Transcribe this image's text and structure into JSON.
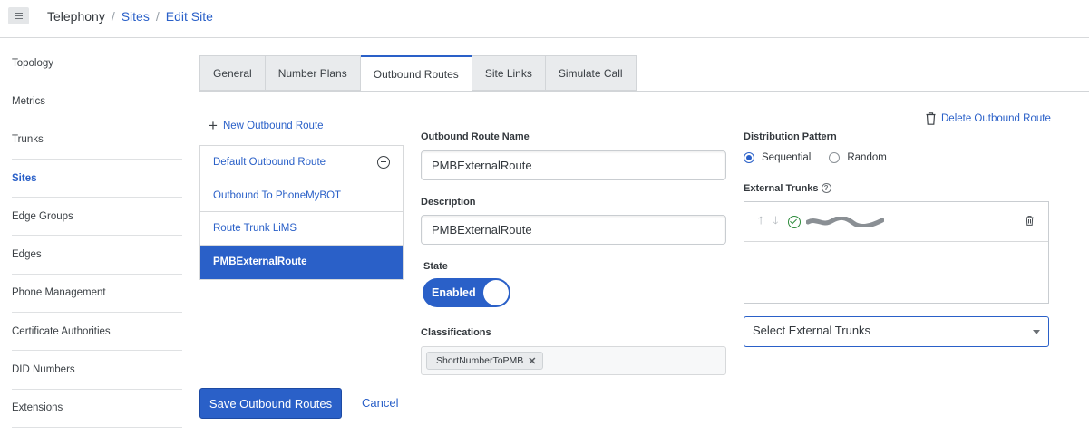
{
  "header": {
    "breadcrumb": [
      "Telephony",
      "Sites",
      "Edit Site"
    ],
    "menu_icon": "hamburger-icon"
  },
  "sidebar": {
    "items": [
      {
        "label": "Topology"
      },
      {
        "label": "Metrics"
      },
      {
        "label": "Trunks"
      },
      {
        "label": "Sites",
        "active": true
      },
      {
        "label": "Edge Groups"
      },
      {
        "label": "Edges"
      },
      {
        "label": "Phone Management"
      },
      {
        "label": "Certificate Authorities"
      },
      {
        "label": "DID Numbers"
      },
      {
        "label": "Extensions"
      }
    ]
  },
  "tabs": [
    {
      "label": "General"
    },
    {
      "label": "Number Plans"
    },
    {
      "label": "Outbound Routes",
      "active": true
    },
    {
      "label": "Site Links"
    },
    {
      "label": "Simulate Call"
    }
  ],
  "routes": {
    "new_label": "New Outbound Route",
    "items": [
      {
        "label": "Default Outbound Route"
      },
      {
        "label": "Outbound To PhoneMyBOT"
      },
      {
        "label": "Route Trunk LiMS"
      },
      {
        "label": "PMBExternalRoute",
        "selected": true
      }
    ]
  },
  "form": {
    "name_label": "Outbound Route Name",
    "name_value": "PMBExternalRoute",
    "description_label": "Description",
    "description_value": "PMBExternalRoute",
    "state_label": "State",
    "state_value": "Enabled",
    "classifications_label": "Classifications",
    "classifications": [
      "ShortNumberToPMB"
    ]
  },
  "right": {
    "delete_label": "Delete Outbound Route",
    "distribution_label": "Distribution Pattern",
    "distribution_options": [
      "Sequential",
      "Random"
    ],
    "distribution_selected": "Sequential",
    "external_trunks_label": "External Trunks",
    "help_glyph": "?",
    "select_placeholder": "Select External Trunks"
  },
  "actions": {
    "save_label": "Save Outbound Routes",
    "cancel_label": "Cancel"
  },
  "colors": {
    "accent": "#2a60c8",
    "success": "#2e8b3c"
  }
}
